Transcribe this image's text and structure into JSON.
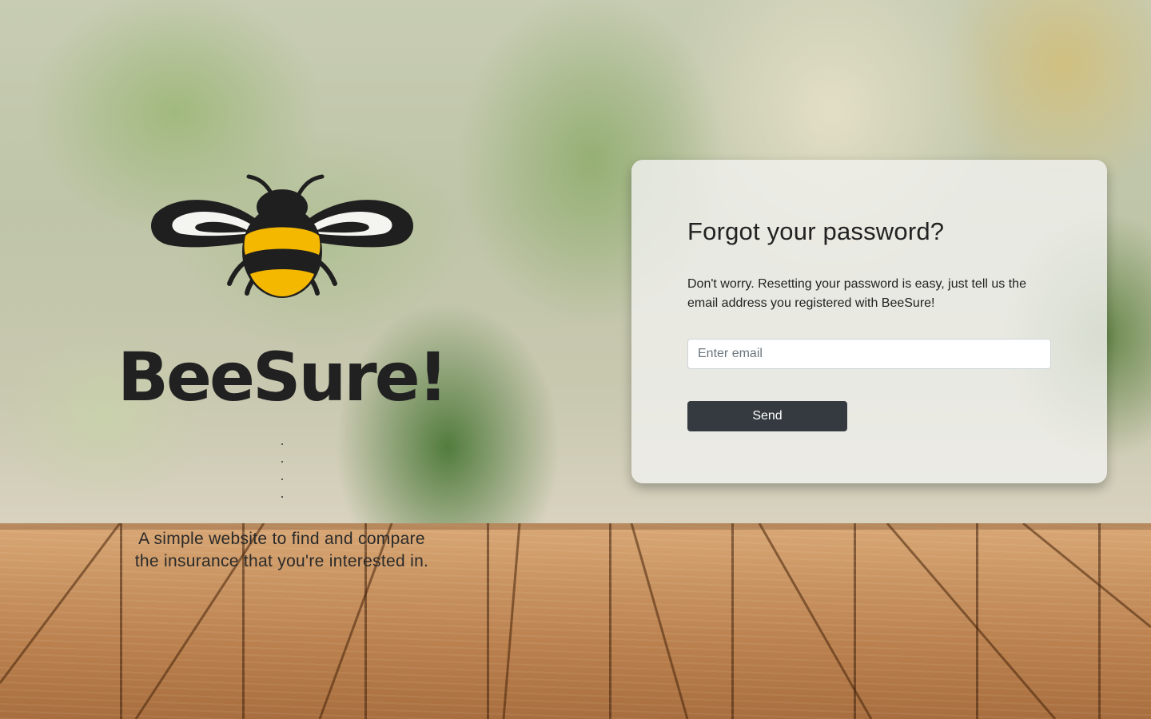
{
  "brand": {
    "name": "BeeSure!",
    "tagline_line1": "A simple website to find and compare",
    "tagline_line2": "the insurance that you're interested in.",
    "logo_icon": "bee-icon"
  },
  "reset_form": {
    "title": "Forgot your password?",
    "description": "Don't worry. Resetting your password is easy, just tell us the email address you registered with BeeSure!",
    "email_placeholder": "Enter email",
    "email_value": "",
    "send_label": "Send"
  },
  "colors": {
    "bee_yellow": "#f5b800",
    "bee_black": "#1f1f1f",
    "button_dark": "#343a40"
  }
}
